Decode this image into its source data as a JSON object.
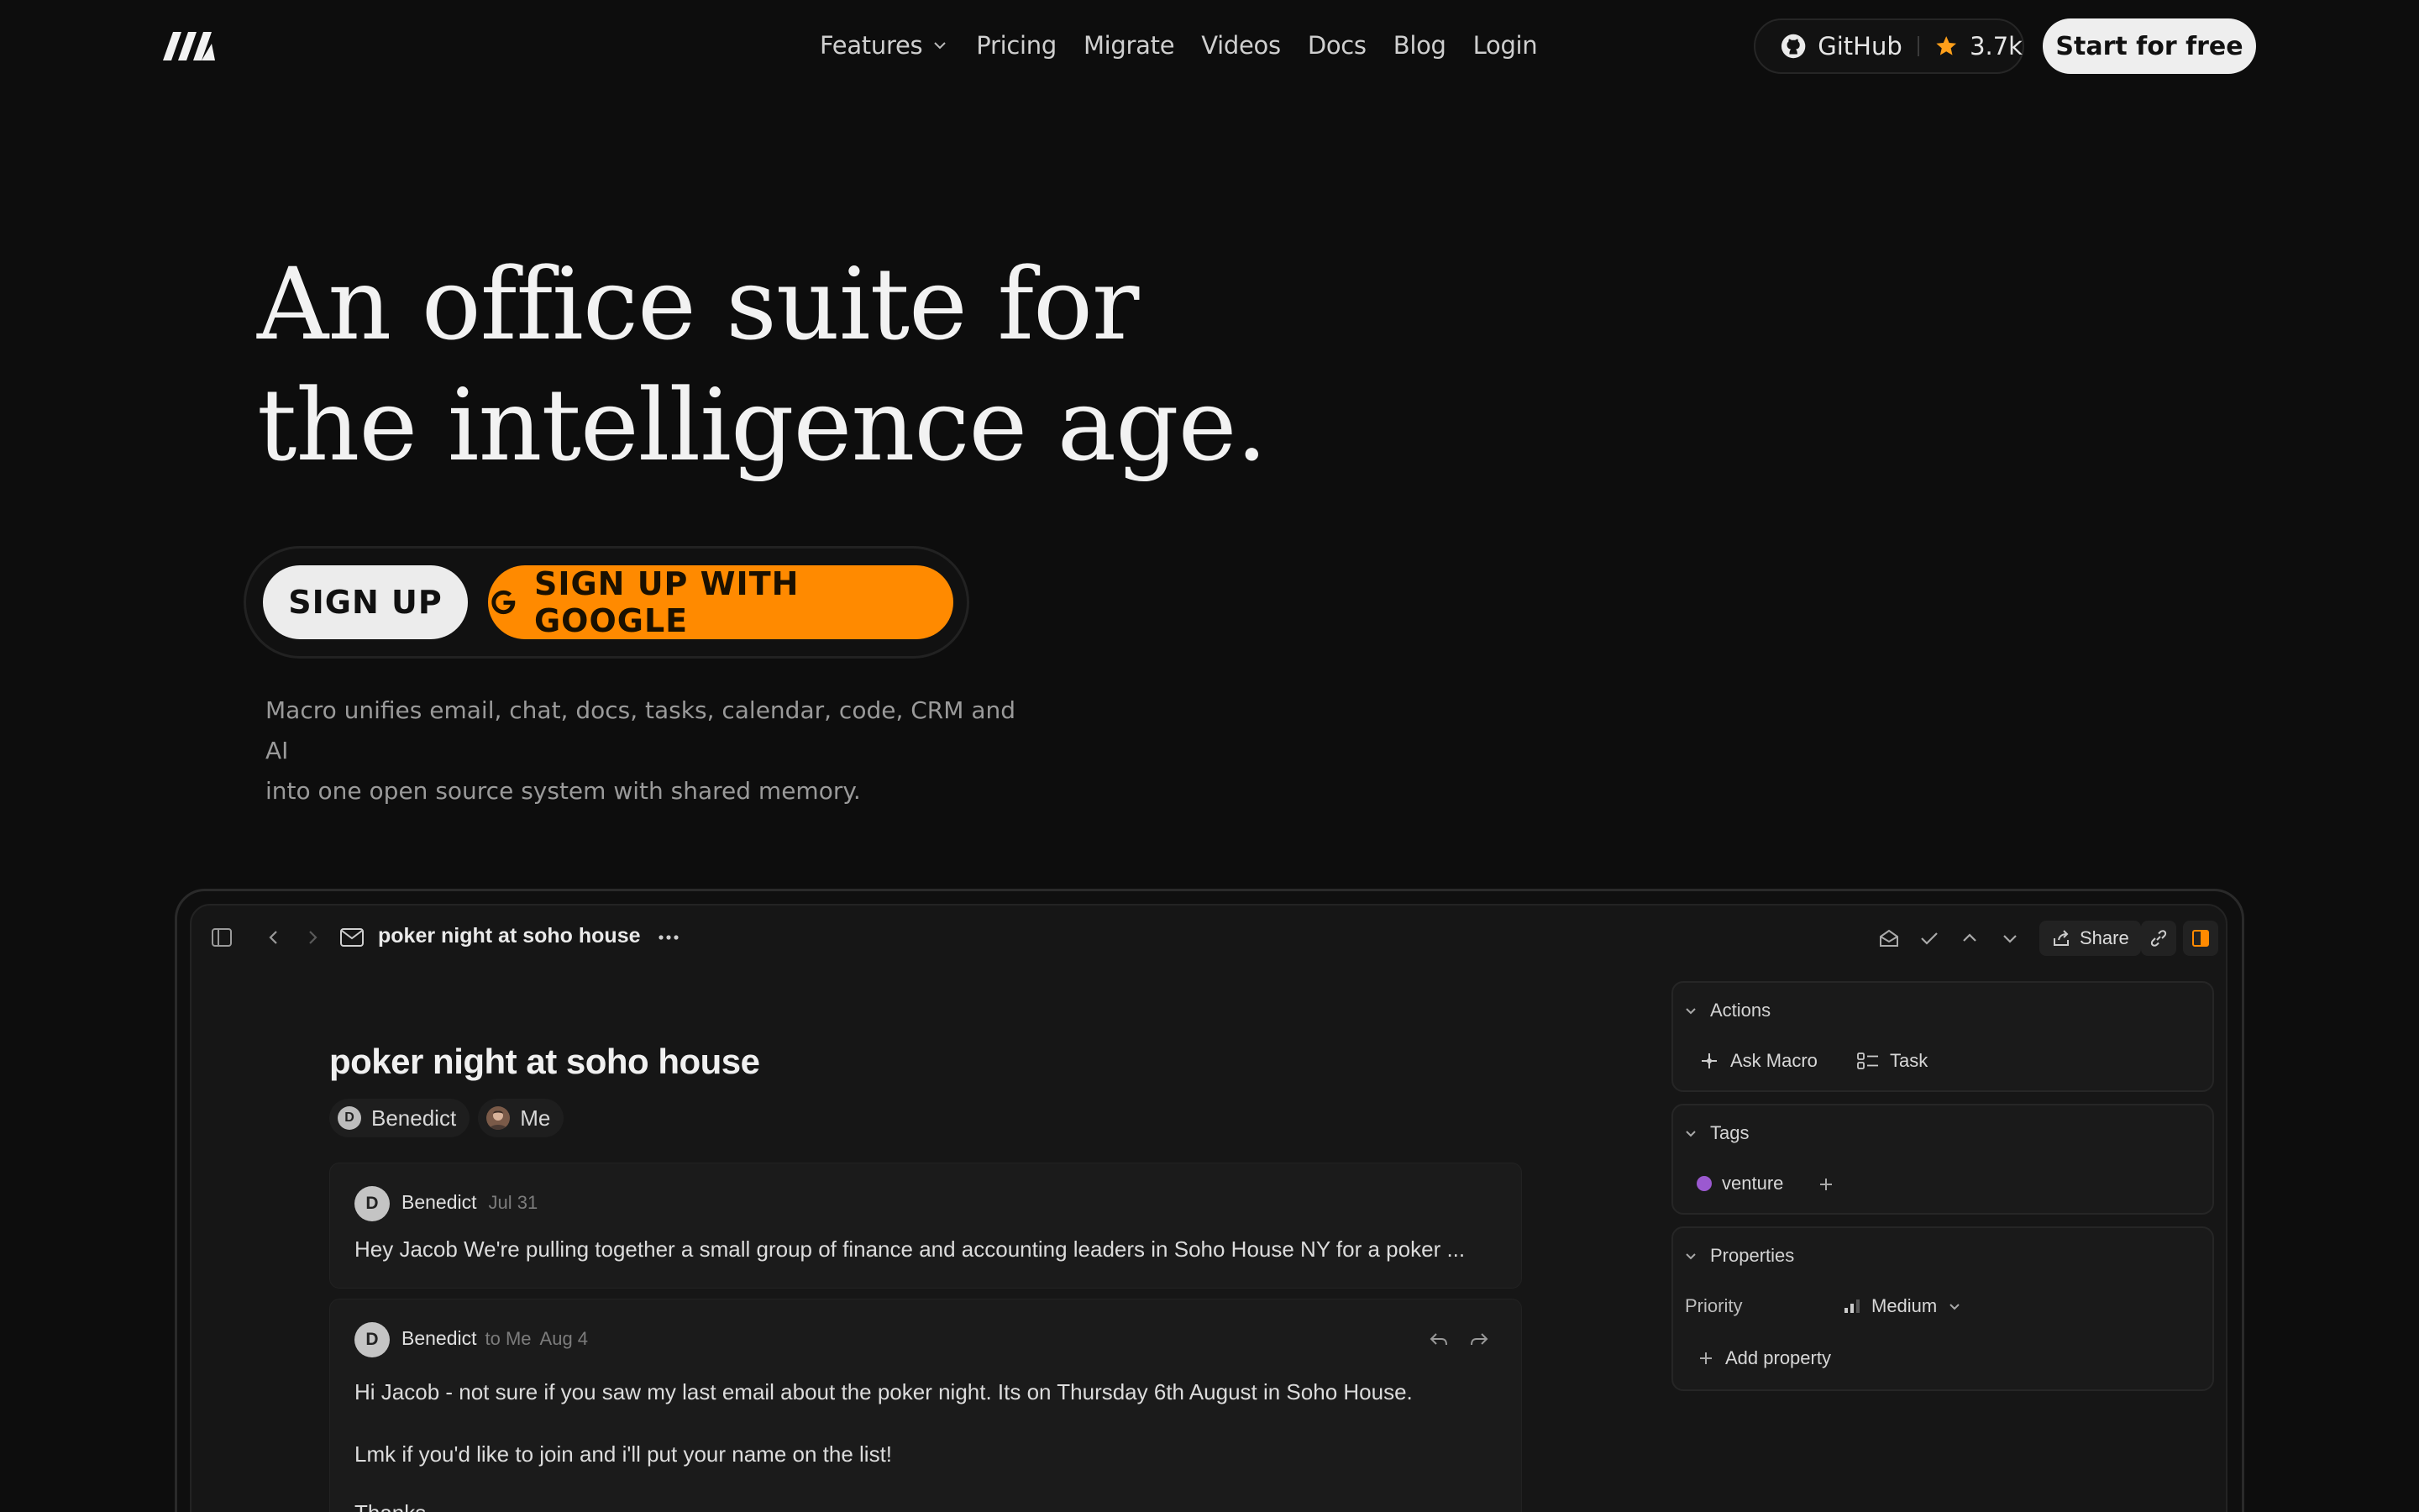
{
  "nav": {
    "links": [
      "Features",
      "Pricing",
      "Migrate",
      "Videos",
      "Docs",
      "Blog",
      "Login"
    ],
    "github_label": "GitHub",
    "github_stars": "3.7k",
    "start_label": "Start for free"
  },
  "hero": {
    "title_line1": "An office suite for",
    "title_line2": "the intelligence age.",
    "signup_label": "SIGN UP",
    "google_label": "SIGN UP WITH GOOGLE",
    "subtitle_line1": "Macro unifies email, chat, docs, tasks, calendar, code, CRM and AI",
    "subtitle_line2": "into one open source system with shared memory."
  },
  "app": {
    "window_title": "poker night at soho house",
    "share_label": "Share",
    "mail_title": "poker night at soho house",
    "participants": [
      {
        "initial": "D",
        "name": "Benedict"
      },
      {
        "initial": "",
        "name": "Me"
      }
    ],
    "messages": [
      {
        "initial": "D",
        "sender": "Benedict",
        "to": "",
        "date": "Jul 31",
        "preview": "Hey Jacob We're pulling together a small group of finance and accounting leaders in Soho House NY for a poker ..."
      },
      {
        "initial": "D",
        "sender": "Benedict",
        "to": "to Me",
        "date": "Aug 4",
        "line1": "Hi Jacob - not sure if you saw my last email about the poker night. Its on Thursday 6th August in Soho House.",
        "line2": "Lmk if you'd like to join and i'll put your name on the list!",
        "line3": "Thanks"
      }
    ],
    "sidebar": {
      "actions_title": "Actions",
      "ask_macro": "Ask Macro",
      "task": "Task",
      "tags_title": "Tags",
      "tag_name": "venture",
      "tag_color": "#9b59d0",
      "properties_title": "Properties",
      "priority_label": "Priority",
      "priority_value": "Medium",
      "add_property": "Add property"
    }
  },
  "colors": {
    "accent": "#ff8a00",
    "background": "#0d0d0d"
  }
}
